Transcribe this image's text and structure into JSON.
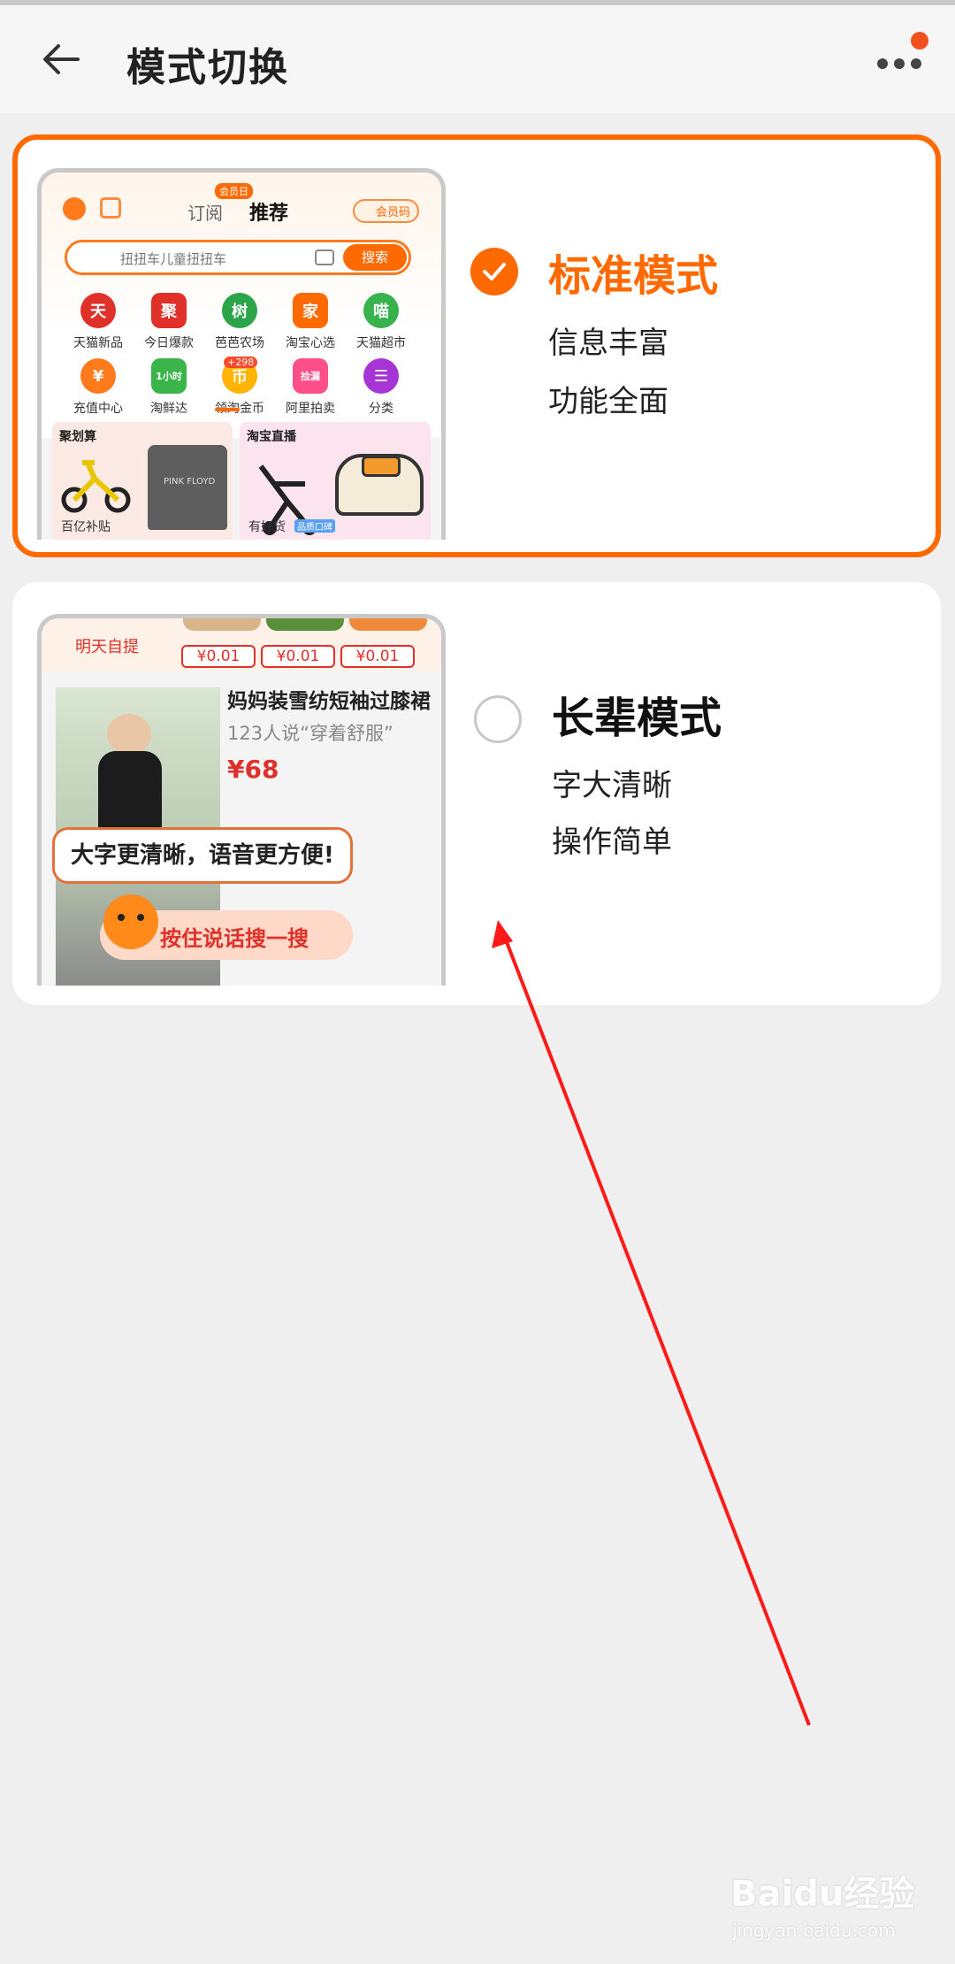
{
  "header": {
    "title": "模式切换"
  },
  "modes": [
    {
      "title": "标准模式",
      "desc_lines": [
        "信息丰富",
        "功能全面"
      ],
      "selected": true,
      "preview": {
        "tab_subscribe": "订阅",
        "tab_subscribe_badge": "会员日",
        "tab_recommend": "推荐",
        "member_code": "会员码",
        "search_placeholder": "扭扭车儿童扭扭车",
        "search_button": "搜索",
        "grid_row1": [
          {
            "label": "天猫新品",
            "icon": "天",
            "color": "#e0302a"
          },
          {
            "label": "今日爆款",
            "icon": "聚",
            "color": "#e0302a"
          },
          {
            "label": "芭芭农场",
            "icon": "树",
            "color": "#2ca44a"
          },
          {
            "label": "淘宝心选",
            "icon": "家",
            "color": "#ff6a00"
          },
          {
            "label": "天猫超市",
            "icon": "喵",
            "color": "#37b24d"
          }
        ],
        "grid_row2": [
          {
            "label": "充值中心",
            "icon": "¥",
            "color": "#ff7a1a"
          },
          {
            "label": "淘鲜达",
            "icon": "1小时",
            "color": "#3bb54a"
          },
          {
            "label": "领淘金币",
            "icon": "币",
            "color": "#ffb400"
          },
          {
            "label": "阿里拍卖",
            "icon": "捡漏",
            "color": "#ff4f8b"
          },
          {
            "label": "分类",
            "icon": "☰",
            "color": "#a735d6"
          }
        ],
        "coin_badge": "+298",
        "sec_left_title": "聚划算",
        "sec_right_title": "淘宝直播",
        "bottom_left": "百亿补贴",
        "bottom_right": "有好货",
        "bottom_right_tag": "品质口碑",
        "tshirt_text": "PINK FLOYD"
      }
    },
    {
      "title": "长辈模式",
      "desc_lines": [
        "字大清晰",
        "操作简单"
      ],
      "selected": false,
      "preview": {
        "pickup_label": "明天自提",
        "prices_top": [
          "¥0.01",
          "¥0.01",
          "¥0.01"
        ],
        "product_title": "妈妈装雪纺短袖过膝裙",
        "product_comment": "123人说“穿着舒服”",
        "product_price": "¥68",
        "bubble_text": "大字更清晰，语音更方便!",
        "voice_button": "按住说话搜一搜"
      }
    }
  ],
  "watermark": {
    "brand": "Baidu经验",
    "url": "jingyan.baidu.com"
  },
  "colors": {
    "accent": "#ff6a00",
    "annotation_arrow": "#ff1a1a"
  }
}
